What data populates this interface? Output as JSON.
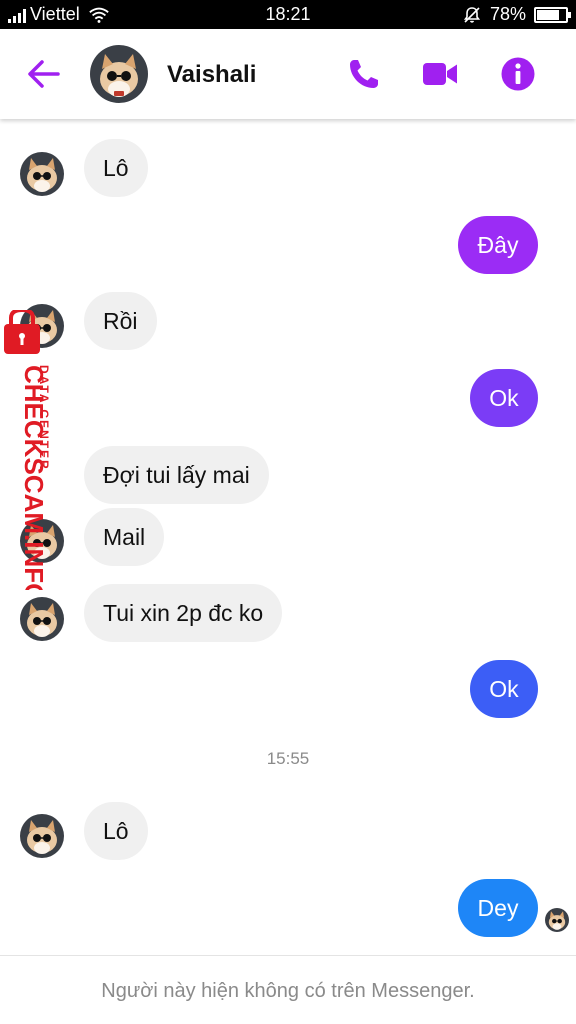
{
  "status_bar": {
    "carrier": "Viettel",
    "time": "18:21",
    "battery": "78%",
    "battery_level": 0.78,
    "icons": [
      "signal-icon",
      "wifi-icon",
      "mute-icon",
      "battery-icon"
    ]
  },
  "header": {
    "name": "Vaishali",
    "icons": [
      "back-arrow-icon",
      "phone-icon",
      "video-camera-icon",
      "info-icon"
    ],
    "accent_color": "#a020f0"
  },
  "messages": [
    {
      "side": "in",
      "text": "Lô",
      "avatar": true
    },
    {
      "side": "out",
      "text": "Đây",
      "color": "#9b2cf5"
    },
    {
      "side": "in",
      "text": "Rồi",
      "avatar": true
    },
    {
      "side": "out",
      "text": "Ok",
      "color": "#7b3cf6"
    },
    {
      "side": "in",
      "text": "Đợi tui lấy mai",
      "avatar": false
    },
    {
      "side": "in",
      "text": "Mail",
      "avatar": true
    },
    {
      "side": "in",
      "text": "Tui xin 2p đc ko",
      "avatar": true
    },
    {
      "side": "out",
      "text": "Ok",
      "color": "#3c5ef6"
    },
    {
      "side": "timestamp",
      "text": "15:55"
    },
    {
      "side": "in",
      "text": "Lô",
      "avatar": true
    },
    {
      "side": "out",
      "text": "Dey",
      "color": "#1e86f7"
    }
  ],
  "watermark": {
    "brand": "CHECKSCAM.INFO",
    "subtitle": "DATA CENTER",
    "color": "#e01b24"
  },
  "footer": {
    "notice": "Người này hiện không có trên Messenger."
  }
}
